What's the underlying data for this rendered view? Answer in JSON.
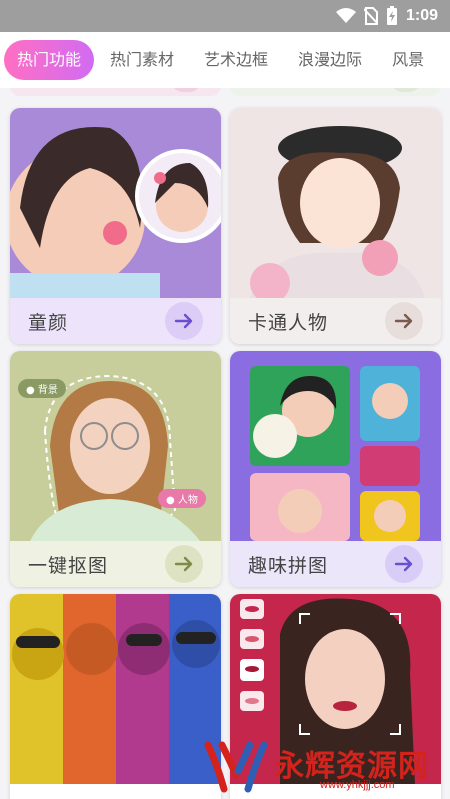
{
  "status_bar": {
    "time": "1:09"
  },
  "tabs": [
    {
      "label": "热门功能",
      "active": true
    },
    {
      "label": "热门素材",
      "active": false
    },
    {
      "label": "艺术边框",
      "active": false
    },
    {
      "label": "浪漫边际",
      "active": false
    },
    {
      "label": "风景",
      "active": false
    }
  ],
  "cards": [
    {
      "title": "童颜",
      "color": "#a98ad8"
    },
    {
      "title": "卡通人物",
      "color": "#e9dfe2"
    },
    {
      "title": "一键抠图",
      "color": "#c9cf9c",
      "tags": [
        "背景",
        "人物"
      ]
    },
    {
      "title": "趣味拼图",
      "color": "#8b6fe0"
    },
    {
      "title": "",
      "color": "#c94b8e"
    },
    {
      "title": "",
      "color": "#c3264b"
    }
  ],
  "watermark": {
    "brand": "永辉资源网",
    "url": "www.yhkjjj.com"
  },
  "colors": {
    "accent_pink": "#ff6fc2",
    "accent_purple": "#d16bf3"
  }
}
